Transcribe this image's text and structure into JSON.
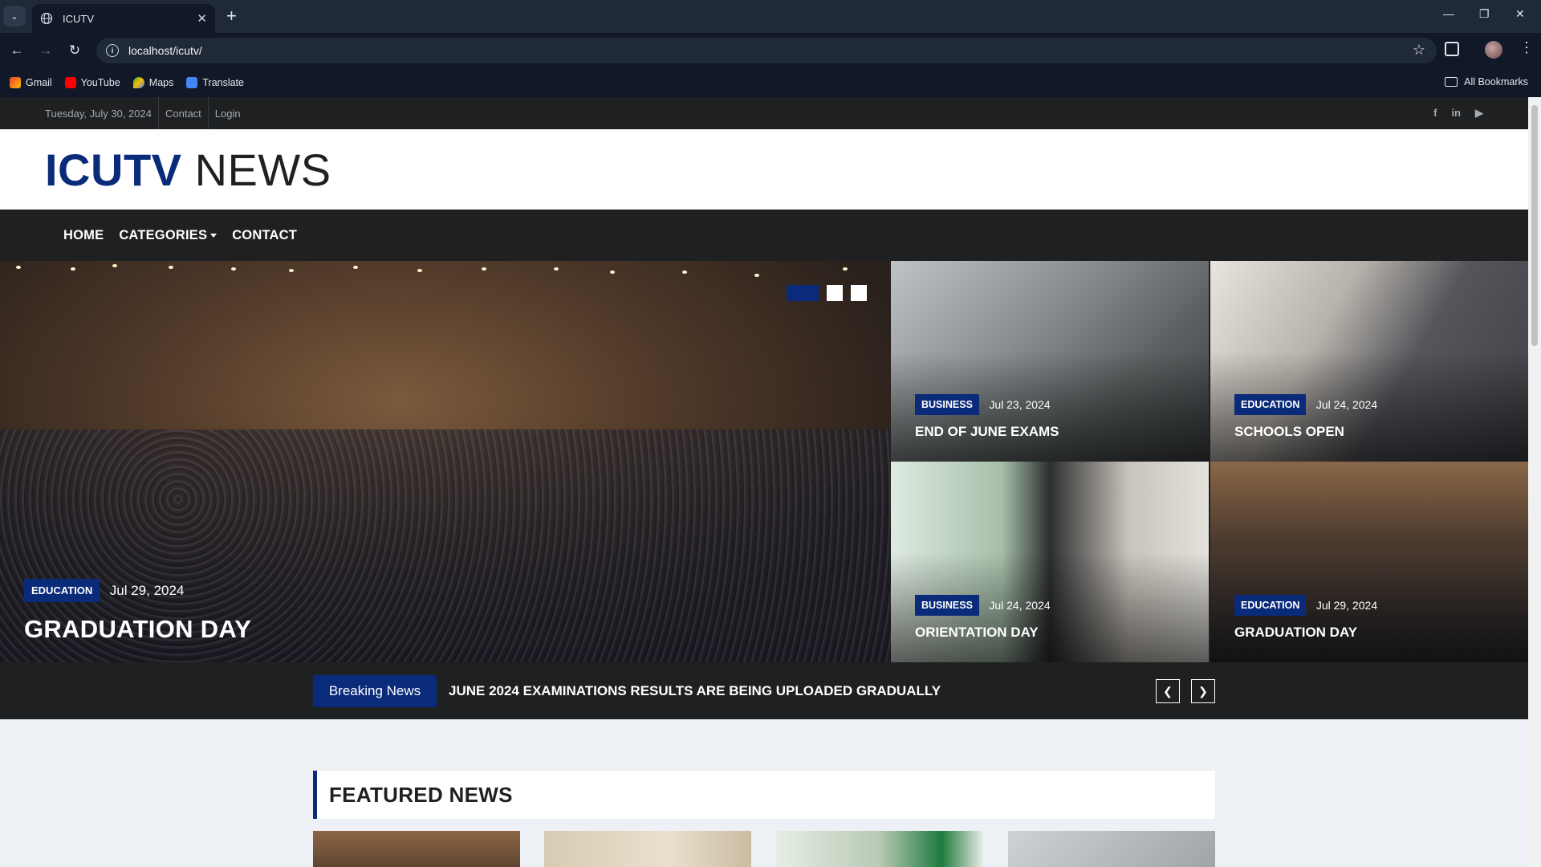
{
  "browser": {
    "tab_title": "ICUTV",
    "url": "localhost/icutv/",
    "bookmarks": [
      "Gmail",
      "YouTube",
      "Maps",
      "Translate"
    ],
    "all_bookmarks": "All Bookmarks"
  },
  "topbar": {
    "date": "Tuesday, July 30, 2024",
    "links": [
      "Contact",
      "Login"
    ],
    "social_icons": [
      "facebook-icon",
      "linkedin-icon",
      "youtube-icon"
    ]
  },
  "brand": {
    "part1": "ICUTV",
    "part2": "NEWS"
  },
  "nav": {
    "items": [
      "HOME",
      "CATEGORIES",
      "CONTACT"
    ]
  },
  "hero": {
    "main": {
      "category": "EDUCATION",
      "date": "Jul 29, 2024",
      "title": "GRADUATION DAY"
    },
    "cards": [
      {
        "category": "BUSINESS",
        "date": "Jul 23, 2024",
        "title": "END OF JUNE EXAMS"
      },
      {
        "category": "EDUCATION",
        "date": "Jul 24, 2024",
        "title": "SCHOOLS OPEN"
      },
      {
        "category": "BUSINESS",
        "date": "Jul 24, 2024",
        "title": "ORIENTATION DAY"
      },
      {
        "category": "EDUCATION",
        "date": "Jul 29, 2024",
        "title": "GRADUATION DAY"
      }
    ],
    "slide_count": 3,
    "active_slide": 1
  },
  "breaking": {
    "label": "Breaking News",
    "text": "JUNE 2024 EXAMINATIONS RESULTS ARE BEING UPLOADED GRADUALLY"
  },
  "featured": {
    "title": "FEATURED NEWS"
  },
  "colors": {
    "accent": "#0a2a7a",
    "dark": "#1e2022",
    "page_bg": "#edf0f5"
  }
}
